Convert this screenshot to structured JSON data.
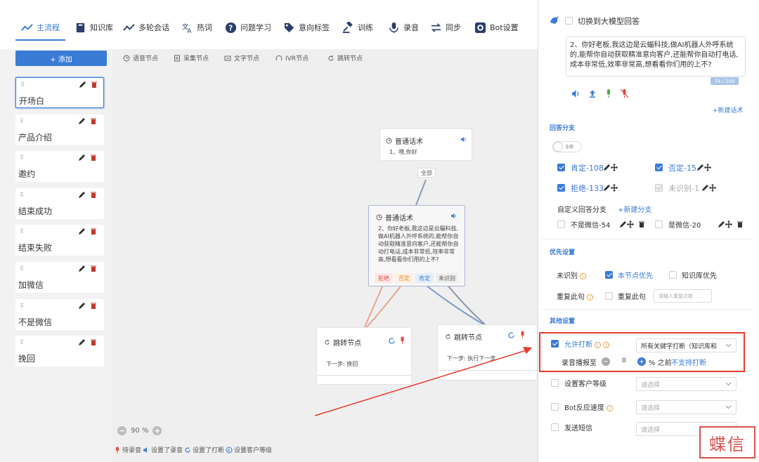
{
  "nav": {
    "tabs": [
      {
        "label": "主流程",
        "icon": "chart-line-icon",
        "active": true
      },
      {
        "label": "知识库",
        "icon": "book-icon"
      },
      {
        "label": "多轮会话",
        "icon": "chart-line-icon"
      },
      {
        "label": "热词",
        "icon": "translate-icon"
      },
      {
        "label": "问题学习",
        "icon": "question-icon"
      },
      {
        "label": "意向标签",
        "icon": "tag-icon"
      },
      {
        "label": "训练",
        "icon": "gavel-icon"
      },
      {
        "label": "录音",
        "icon": "mic-icon"
      },
      {
        "label": "同步",
        "icon": "swap-icon"
      },
      {
        "label": "Bot设置",
        "icon": "gear-icon"
      }
    ]
  },
  "sidebar": {
    "add_label": "+ 添加",
    "items": [
      {
        "label": "开场白",
        "active": true
      },
      {
        "label": "产品介绍"
      },
      {
        "label": "邀约"
      },
      {
        "label": "结束成功"
      },
      {
        "label": "结束失败"
      },
      {
        "label": "加微信"
      },
      {
        "label": "不是微信"
      },
      {
        "label": "挽回"
      }
    ]
  },
  "toolbar": {
    "buttons": [
      "语音节点",
      "采集节点",
      "文字节点",
      "IVR节点",
      "跳转节点"
    ]
  },
  "nodes": {
    "n1": {
      "title": "普通话术",
      "body": "1、喂,你好",
      "port": "全部"
    },
    "n2": {
      "title": "普通话术",
      "body": "2、你好老板,我这边是云蝠科技,做AI机器人外呼系统的,能帮你自动获取精准意向客户,还能帮你自动打电话,成本非常低,效率非常高,想看看你们用的上不?",
      "ports": [
        "拒绝",
        "否定",
        "肯定",
        "未识别"
      ]
    },
    "n3": {
      "title": "跳转节点",
      "next": "下一步: 挽回"
    },
    "n4": {
      "title": "跳转节点",
      "next": "下一步: 执行下一步"
    }
  },
  "zoom": {
    "level": "90 %"
  },
  "legend": [
    "待录音",
    "设置了录音",
    "设置了打断",
    "设置客户等级"
  ],
  "panel": {
    "switch_llm": "切换到大模型回答",
    "script_text": "2、你好老板,我这边是云蝠科技,做AI机器人外呼系统的,能帮你自动获取精准意向客户,还能帮你自动打电话,成本非常低,效率非常高,想看看你们用的上不?",
    "counter": "74 / 200",
    "new_script": "+新建话术",
    "branch_title": "回答分支",
    "toggle_label": "全部",
    "branches": [
      {
        "label": "肯定-108",
        "checked": true
      },
      {
        "label": "否定-15",
        "checked": true
      },
      {
        "label": "拒绝-133",
        "checked": true
      },
      {
        "label": "未识别-1",
        "checked": "disabled"
      }
    ],
    "custom_branch_label": "自定义回答分支",
    "new_branch": "+新建分支",
    "custom_branches": [
      "不是微信-54",
      "是微信-20"
    ],
    "priority_title": "优先设置",
    "unrecognized_label": "未识别",
    "this_node_first": "本节点优先",
    "kb_first": "知识库优先",
    "repeat_label": "重复此句",
    "repeat_cb": "重复此句",
    "repeat_placeholder": "请输入重复次数",
    "other_title": "其他设置",
    "allow_interrupt": "允许打断",
    "interrupt_select": "所有关键字打断（知识库和",
    "playback_label": "录音播报至",
    "playback_value": "0",
    "playback_suffix": "% 之前",
    "no_interrupt": "不支持打断",
    "customer_level": "设置客户等级",
    "bot_speed": "Bot反应速度",
    "send_sms": "发送短信",
    "select_placeholder": "请选择"
  },
  "watermark": "蝶信"
}
